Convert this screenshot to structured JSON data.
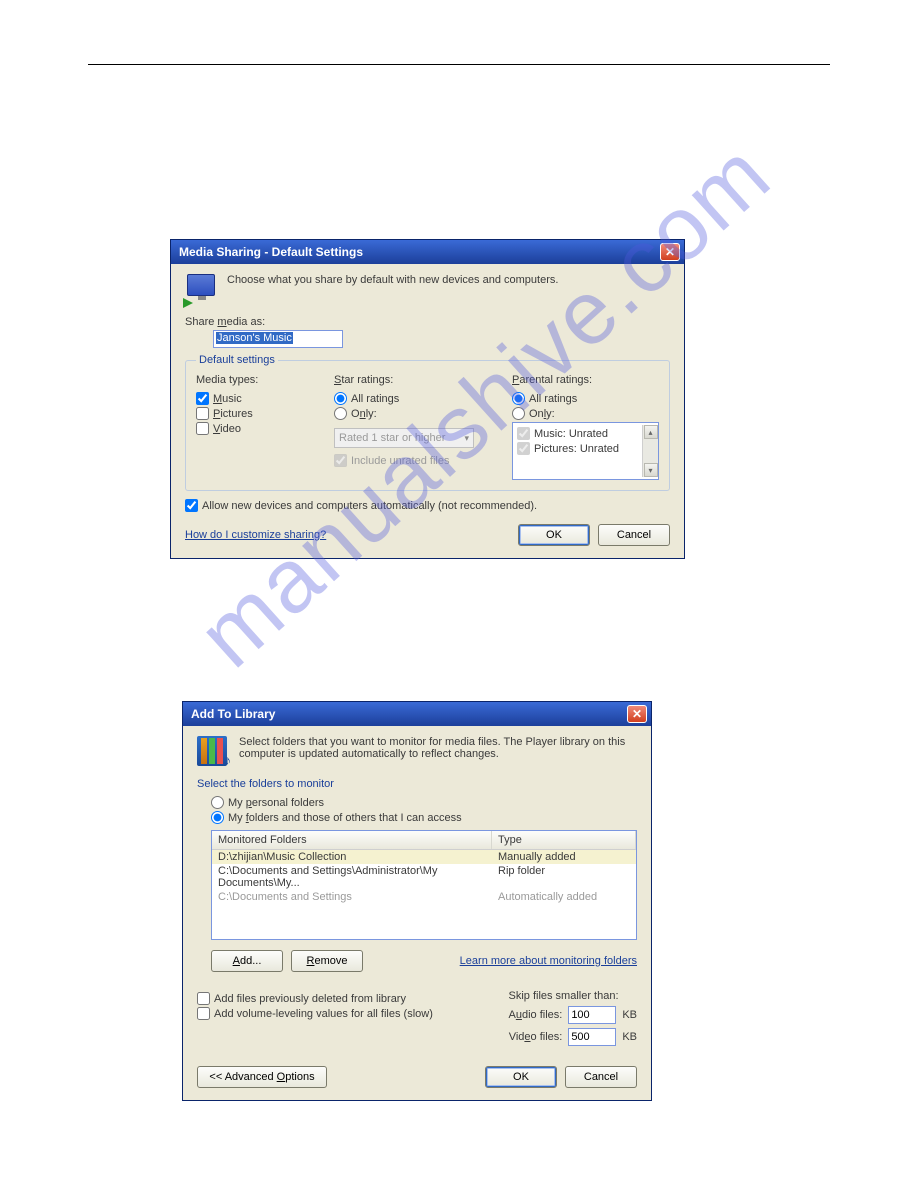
{
  "watermark": "manualshive.com",
  "dialog1": {
    "title": "Media Sharing - Default Settings",
    "intro": "Choose what you share by default with new devices and computers.",
    "share_as_label": "Share media as:",
    "share_as_value": "Janson's Music",
    "group_legend": "Default settings",
    "media_types_label": "Media types:",
    "media": {
      "music": "Music",
      "pictures": "Pictures",
      "video": "Video"
    },
    "star_label": "Star ratings:",
    "star_all": "All ratings",
    "star_only": "Only:",
    "star_dropdown": "Rated 1 star or higher",
    "include_unrated": "Include unrated files",
    "parental_label": "Parental ratings:",
    "parental_all": "All ratings",
    "parental_only": "Only:",
    "parental_items": {
      "music": "Music: Unrated",
      "pictures": "Pictures: Unrated"
    },
    "allow_new": "Allow new devices and computers automatically (not recommended).",
    "help_link": "How do I customize sharing?",
    "ok": "OK",
    "cancel": "Cancel"
  },
  "dialog2": {
    "title": "Add To Library",
    "intro": "Select folders that you want to monitor for media files. The Player library on this computer is updated automatically to reflect changes.",
    "select_heading": "Select the folders to monitor",
    "opt_personal": "My personal folders",
    "opt_others": "My folders and those of others that I can access",
    "col_folders": "Monitored Folders",
    "col_type": "Type",
    "rows": [
      {
        "path": "D:\\zhijian\\Music Collection",
        "type": "Manually added"
      },
      {
        "path": "C:\\Documents and Settings\\Administrator\\My Documents\\My...",
        "type": "Rip folder"
      },
      {
        "path": "C:\\Documents and Settings",
        "type": "Automatically added"
      }
    ],
    "add": "Add...",
    "remove": "Remove",
    "learn_link": "Learn more about monitoring folders",
    "add_deleted": "Add files previously deleted from library",
    "add_leveling": "Add volume-leveling values for all files (slow)",
    "skip_label": "Skip files smaller than:",
    "audio_label": "Audio files:",
    "audio_value": "100",
    "video_label": "Video files:",
    "video_value": "500",
    "kb": "KB",
    "adv": "<< Advanced Options",
    "ok": "OK",
    "cancel": "Cancel"
  }
}
